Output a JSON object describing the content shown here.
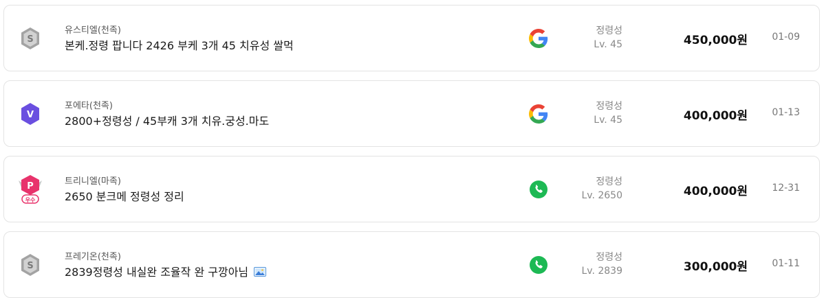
{
  "listings": [
    {
      "grade_icon": "silver-s-shield-icon",
      "seller": "유스티엘(천족)",
      "title": "본케.정령 팝니다 2426 부케 3개 45 치유성 쌀먹",
      "has_image": false,
      "auth_icon": "google-icon",
      "job": "정령성",
      "level": "Lv. 45",
      "price": "450,000원",
      "date": "01-09"
    },
    {
      "grade_icon": "purple-v-hexagon-icon",
      "seller": "포에타(천족)",
      "title": "2800+정령성 / 45부캐 3개 치유.궁성.마도",
      "has_image": false,
      "auth_icon": "google-icon",
      "job": "정령성",
      "level": "Lv. 45",
      "price": "400,000원",
      "date": "01-13"
    },
    {
      "grade_icon": "pink-p-excellent-badge-icon",
      "grade_badge_text": "우수",
      "grade_letter": "P",
      "seller": "트리니엘(마족)",
      "title": "2650 분크메 정령성 정리",
      "has_image": false,
      "auth_icon": "phone-icon",
      "job": "정령성",
      "level": "Lv. 2650",
      "price": "400,000원",
      "date": "12-31"
    },
    {
      "grade_icon": "silver-s-shield-icon",
      "seller": "프레기온(천족)",
      "title": "2839정령성 내실완 조율작 완 구깡아님",
      "has_image": true,
      "auth_icon": "phone-icon",
      "job": "정령성",
      "level": "Lv. 2839",
      "price": "300,000원",
      "date": "01-11"
    }
  ],
  "colors": {
    "google_blue": "#4285F4",
    "google_red": "#EA4335",
    "google_yellow": "#FBBC05",
    "google_green": "#34A853",
    "phone_green": "#1DB954",
    "grade_purple": "#6A4FE0",
    "grade_pink": "#E8336C",
    "grade_silver": "#9a9a9a"
  }
}
